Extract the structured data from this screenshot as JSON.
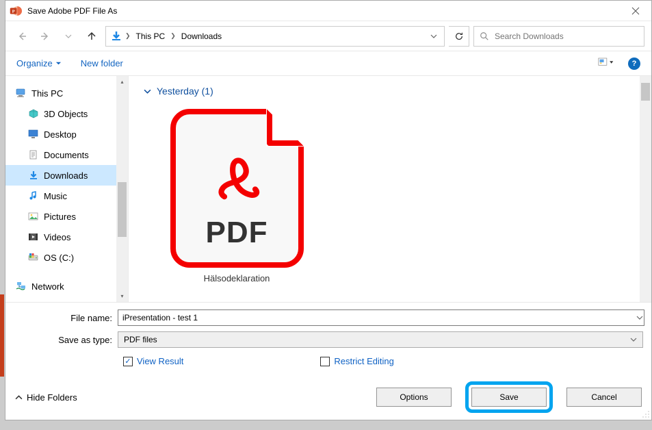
{
  "title": "Save Adobe PDF File As",
  "path": {
    "root": "This PC",
    "folder": "Downloads"
  },
  "search_placeholder": "Search Downloads",
  "toolbar": {
    "organize": "Organize",
    "new_folder": "New folder"
  },
  "tree": [
    {
      "label": "This PC",
      "icon": "pc"
    },
    {
      "label": "3D Objects",
      "icon": "3d",
      "indent": true
    },
    {
      "label": "Desktop",
      "icon": "desktop",
      "indent": true
    },
    {
      "label": "Documents",
      "icon": "documents",
      "indent": true
    },
    {
      "label": "Downloads",
      "icon": "downloads",
      "indent": true,
      "selected": true
    },
    {
      "label": "Music",
      "icon": "music",
      "indent": true
    },
    {
      "label": "Pictures",
      "icon": "pictures",
      "indent": true
    },
    {
      "label": "Videos",
      "icon": "videos",
      "indent": true
    },
    {
      "label": "OS (C:)",
      "icon": "drive",
      "indent": true
    },
    {
      "label": "Network",
      "icon": "network"
    }
  ],
  "group_header": "Yesterday (1)",
  "file_item_name": "Hälsodeklaration",
  "filename_label": "File name:",
  "filename_value": "iPresentation - test 1",
  "filetype_label": "Save as type:",
  "filetype_value": "PDF files",
  "check_view": "View Result",
  "check_restrict": "Restrict Editing",
  "hide_folders": "Hide Folders",
  "buttons": {
    "options": "Options",
    "save": "Save",
    "cancel": "Cancel"
  }
}
